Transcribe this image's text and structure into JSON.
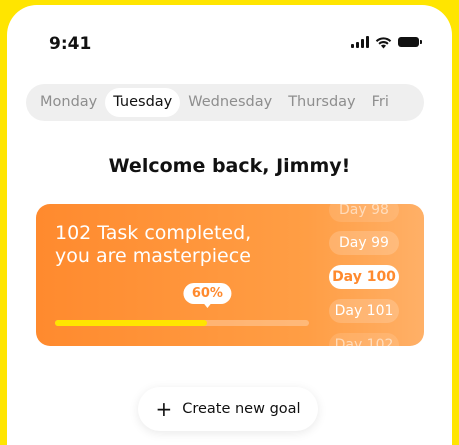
{
  "status_bar": {
    "time": "9:41",
    "icons": [
      "signal-icon",
      "wifi-icon",
      "battery-icon"
    ]
  },
  "day_tabs": {
    "items": [
      {
        "label": "Monday",
        "active": false
      },
      {
        "label": "Tuesday",
        "active": true
      },
      {
        "label": "Wednesday",
        "active": false
      },
      {
        "label": "Thursday",
        "active": false
      },
      {
        "label": "Fri",
        "active": false
      }
    ]
  },
  "welcome": "Welcome back, Jimmy!",
  "progress_card": {
    "title_line1": "102 Task completed,",
    "title_line2": "you are masterpiece",
    "progress_label": "60%",
    "progress_value": 0.6,
    "days": [
      {
        "label": "Day 98",
        "state": "faint"
      },
      {
        "label": "Day 99",
        "state": "normal"
      },
      {
        "label": "Day 100",
        "state": "current"
      },
      {
        "label": "Day 101",
        "state": "normal"
      },
      {
        "label": "Day 102",
        "state": "faint"
      }
    ]
  },
  "create_goal": {
    "icon": "plus-icon",
    "label": "Create new goal"
  },
  "colors": {
    "background": "#FFE500",
    "accent_orange": "#FF8A2E",
    "progress_fill": "#FFE500",
    "tab_track": "#EFEFEF"
  }
}
